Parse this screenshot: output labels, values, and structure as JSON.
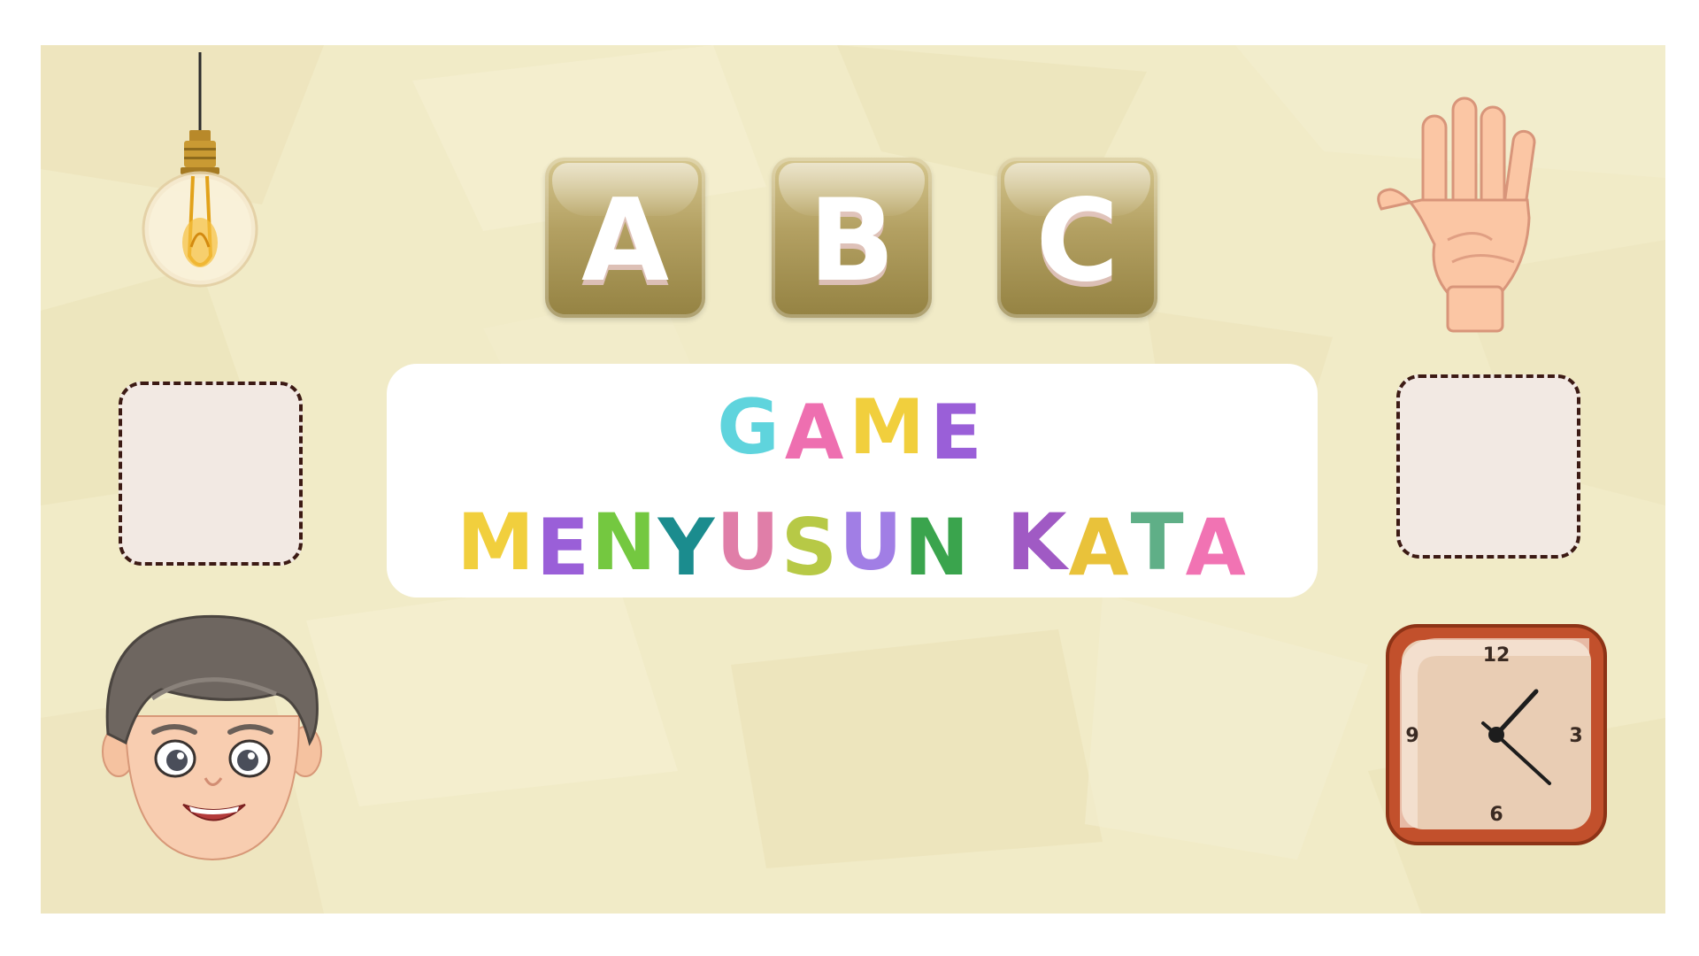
{
  "slide": {
    "background_color": "#f1ebc7",
    "abc_tiles": [
      "A",
      "B",
      "C"
    ],
    "title": {
      "line1": "GAME",
      "line2_word1": "MENYUSUN",
      "line2_word2": "KATA"
    },
    "title_letter_colors": {
      "G": "#5fd4dd",
      "A": "#ee6fb0",
      "M": "#f1cf3d",
      "E": "#9a5fd8",
      "M2": "#f1cf3d",
      "E2": "#9a5fd8",
      "N": "#74c840",
      "Y": "#1b8c8e",
      "U": "#e07ea8",
      "S": "#b7c946",
      "U2": "#a17ee5",
      "N2": "#3aa44d",
      "K": "#a05ac4",
      "A2": "#e9c23a",
      "T": "#5faf87",
      "A3": "#f173b3"
    },
    "clock_numbers": [
      "12",
      "3",
      "6",
      "9"
    ],
    "icons": [
      "light-bulb-icon",
      "hand-icon",
      "boy-face-icon",
      "clock-icon"
    ]
  }
}
